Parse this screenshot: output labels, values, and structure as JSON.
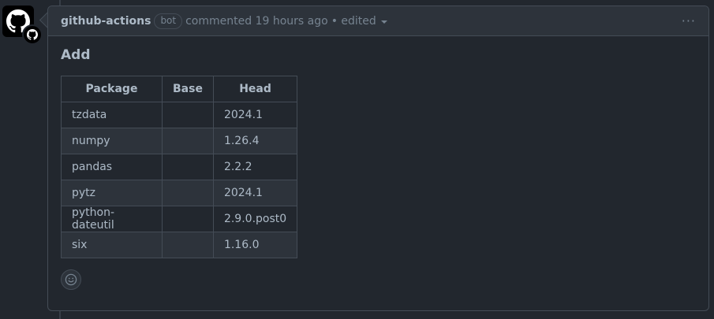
{
  "comment": {
    "author": "github-actions",
    "bot_label": "bot",
    "meta": "commented 19 hours ago",
    "edited": "• edited",
    "menu": "···"
  },
  "body": {
    "heading": "Add",
    "table": {
      "headers": [
        "Package",
        "Base",
        "Head"
      ],
      "rows": [
        {
          "package": "tzdata",
          "base": "",
          "head": "2024.1"
        },
        {
          "package": "numpy",
          "base": "",
          "head": "1.26.4"
        },
        {
          "package": "pandas",
          "base": "",
          "head": "2.2.2"
        },
        {
          "package": "pytz",
          "base": "",
          "head": "2024.1"
        },
        {
          "package": "python-dateutil",
          "base": "",
          "head": "2.9.0.post0"
        },
        {
          "package": "six",
          "base": "",
          "head": "1.16.0"
        }
      ]
    }
  },
  "icons": {
    "avatar": "github-logo-icon",
    "badge": "github-mark-icon",
    "reaction": "smiley-icon",
    "menu": "kebab-horizontal-icon"
  }
}
